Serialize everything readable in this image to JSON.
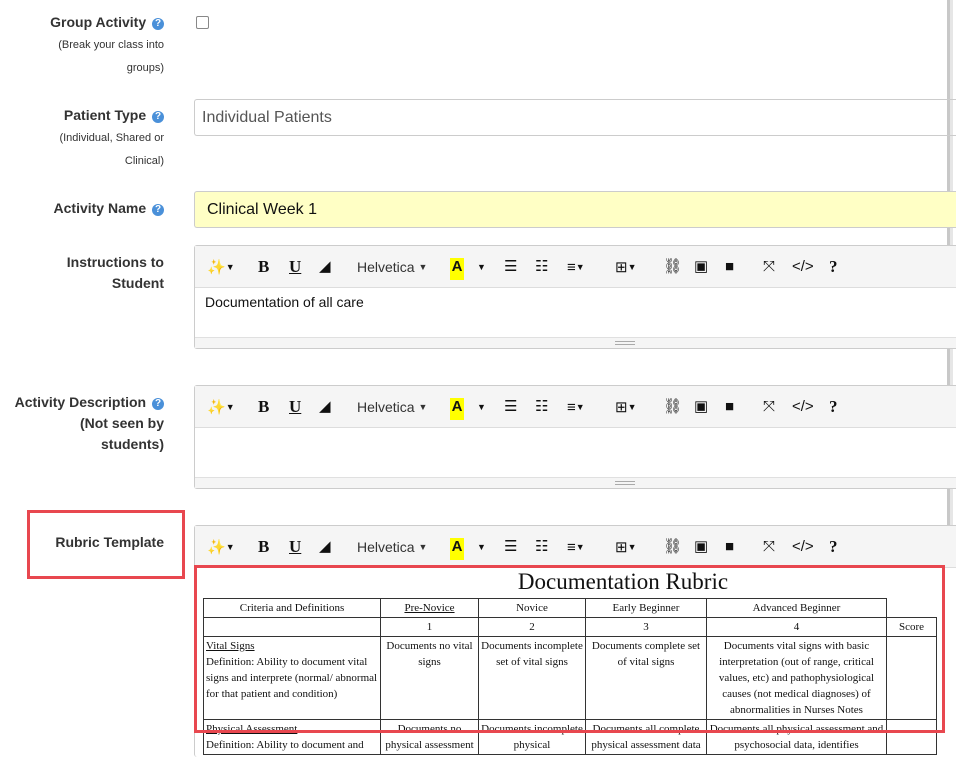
{
  "group_activity": {
    "label": "Group Activity",
    "sub1": "(Break your class into",
    "sub2": "groups)",
    "checked": false
  },
  "patient_type": {
    "label": "Patient Type",
    "sub1": "(Individual, Shared or",
    "sub2": "Clinical)",
    "value": "Individual Patients"
  },
  "activity_name": {
    "label": "Activity Name",
    "value": "Clinical Week 1"
  },
  "instructions": {
    "label1": "Instructions to",
    "label2": "Student",
    "content": "Documentation of all care"
  },
  "activity_description": {
    "label1": "Activity Description",
    "label2": "(Not seen by",
    "label3": "students)",
    "content": ""
  },
  "rubric": {
    "label": "Rubric Template",
    "title": "Documentation Rubric",
    "headers": [
      "Criteria and Definitions",
      "Pre-Novice",
      "Novice",
      "Early Beginner",
      "Advanced Beginner"
    ],
    "levels": [
      "1",
      "2",
      "3",
      "4"
    ],
    "score_label": "Score",
    "rows": [
      {
        "name": "Vital Signs",
        "definition": "Definition:  Ability to document vital signs and interprete (normal/ abnormal for that patient and condition)",
        "cells": [
          "Documents no vital signs",
          "Documents incomplete set of vital signs",
          "Documents complete set of vital signs",
          "Documents vital signs with basic interpretation (out of range, critical values, etc) and  pathophysiological causes (not medical diagnoses) of abnormalities in Nurses Notes"
        ]
      },
      {
        "name": "Physical Assessment",
        "definition": "Definition:  Ability to document and",
        "cells": [
          "Documents no physical assessment",
          "Documents incomplete physical",
          "Documents all complete physical assessment data",
          "Documents all physical assessment and psychosocial data, identifies"
        ]
      }
    ]
  },
  "toolbar": {
    "font_name": "Helvetica",
    "highlight_letter": "A",
    "bold": "B",
    "underline": "U",
    "codeview": "</>",
    "help": "?"
  },
  "colors": {
    "accent": "#4a90d9",
    "highlight_box": "#e8474f",
    "name_field_bg": "#ffffc5"
  }
}
